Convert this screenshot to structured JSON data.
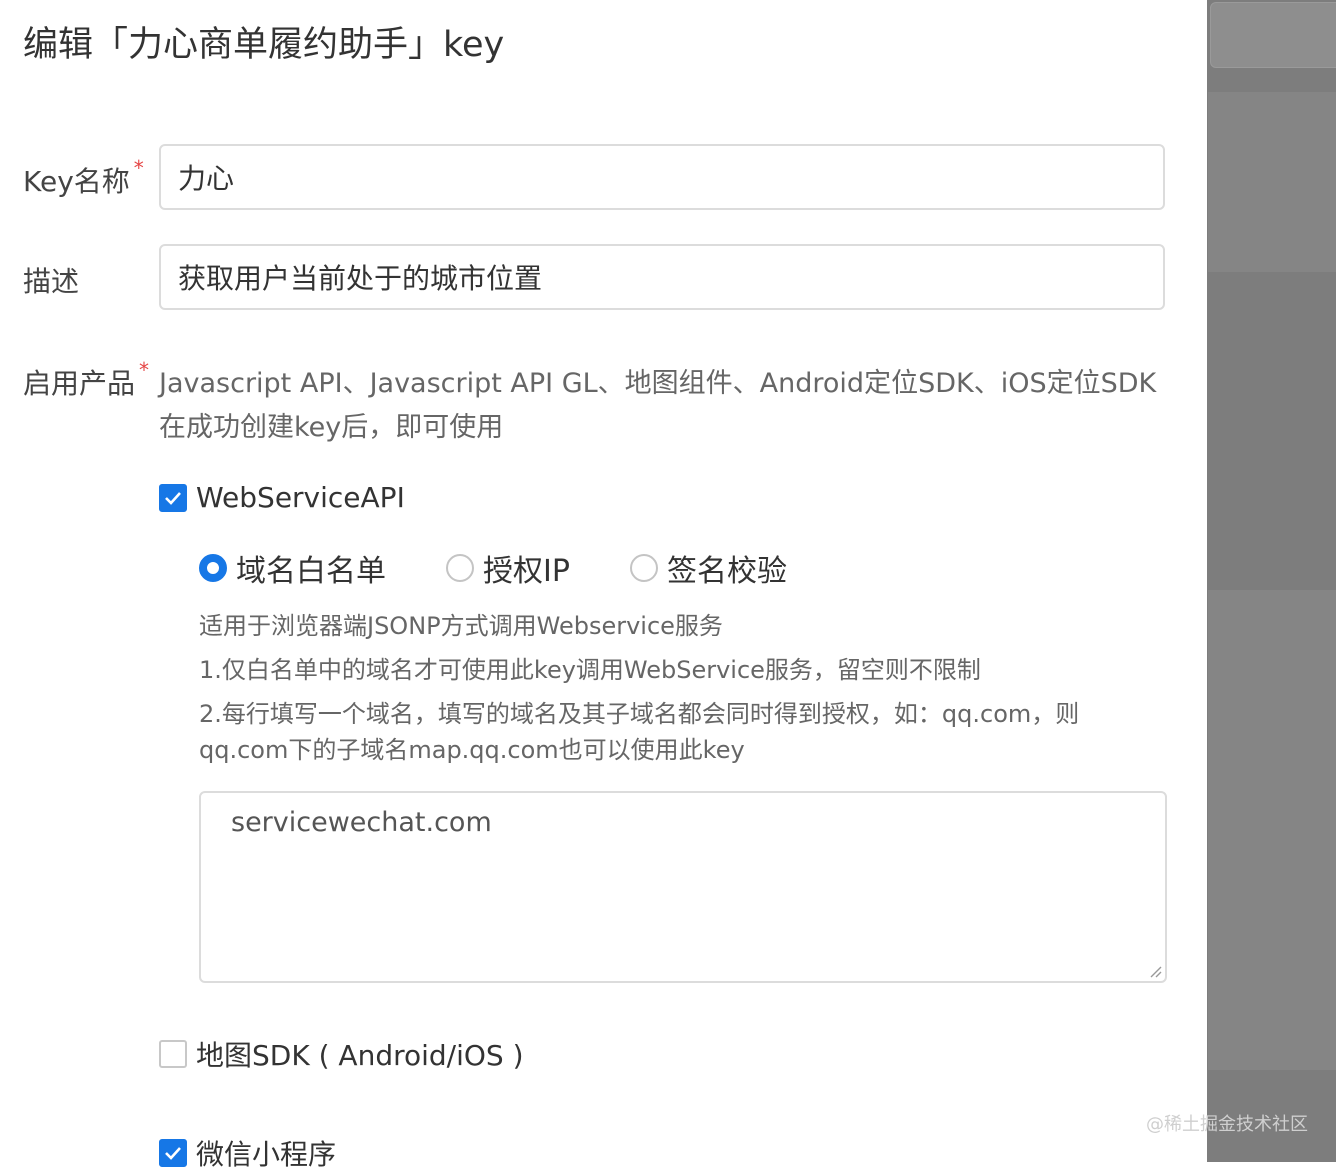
{
  "dialog": {
    "title": "编辑「力心商单履约助手」key"
  },
  "form": {
    "key_name": {
      "label": "Key名称",
      "required_mark": "*",
      "value": "力心"
    },
    "description": {
      "label": "描述",
      "value": "获取用户当前处于的城市位置"
    },
    "products": {
      "label": "启用产品",
      "required_mark": "*",
      "enabled_text": "Javascript API、Javascript API GL、地图组件、Android定位SDK、iOS定位SDK在成功创建key后，即可使用",
      "webservice": {
        "label": "WebServiceAPI",
        "checked": true,
        "auth_modes": [
          {
            "label": "域名白名单",
            "selected": true
          },
          {
            "label": "授权IP",
            "selected": false
          },
          {
            "label": "签名校验",
            "selected": false
          }
        ],
        "hints": [
          "适用于浏览器端JSONP方式调用Webservice服务",
          "1.仅白名单中的域名才可使用此key调用WebService服务，留空则不限制",
          "2.每行填写一个域名，填写的域名及其子域名都会同时得到授权，如：qq.com，则qq.com下的子域名map.qq.com也可以使用此key"
        ],
        "whitelist_value": "servicewechat.com"
      },
      "map_sdk": {
        "label": "地图SDK ( Android/iOS )",
        "checked": false
      },
      "miniprogram": {
        "label": "微信小程序",
        "checked": true
      }
    }
  },
  "watermark": "@稀土掘金技术社区",
  "colors": {
    "accent": "#1677e6",
    "required": "#e54545",
    "overlay": "#7d7d7d"
  }
}
